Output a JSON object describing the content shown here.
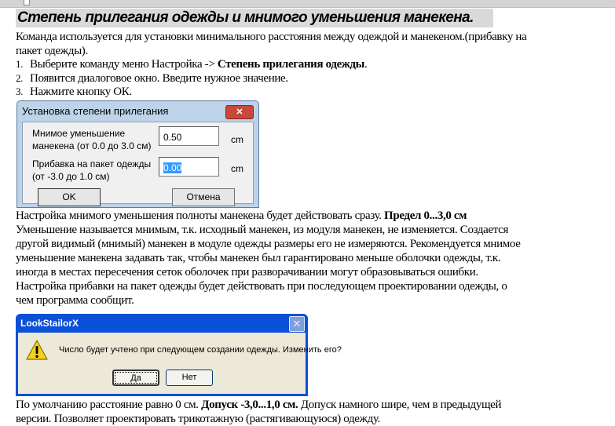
{
  "heading": "Степень прилегания одежды и мнимого уменьшения манекена.",
  "intro": {
    "lines": [
      "Команда используется для установки минимального расстояния между одеждой и манекеном.(прибавку на",
      "пакет одежды)."
    ]
  },
  "steps": [
    {
      "num": "1.",
      "text": "Выберите команду меню Настройка -> ",
      "bold": "Степень прилегания одежды",
      "tail": "."
    },
    {
      "num": "2.",
      "text": "Появится диалоговое окно. Введите нужное значение."
    },
    {
      "num": "3.",
      "text": "Нажмите кнопку ОК."
    }
  ],
  "dialog_fit": {
    "title": "Установка степени прилегания",
    "close_label": "✕",
    "field1": {
      "label_line1": "Мнимое уменьшение",
      "label_line2": "манекена (от 0.0 до 3.0 см)",
      "value": "0.50",
      "unit": "cm"
    },
    "field2": {
      "label_line1": "Прибавка на пакет одежды",
      "label_line2": "(от -3.0 до 1.0 см)",
      "value": "0.00",
      "unit": "cm"
    },
    "ok_label": "OK",
    "cancel_label": "Отмена"
  },
  "body": {
    "line1": {
      "text": "Настройка мнимого уменьшения полноты манекена будет действовать сразу. ",
      "bold": "Предел 0...3,0 см"
    },
    "lines": [
      "Уменьшение называется мнимым, т.к. исходный манекен, из модуля манекен, не изменяется. Создается",
      "другой видимый (мнимый) манекен в модуле одежды размеры его не измеряются. Рекомендуется мнимое",
      "уменьшение манекена задавать так, чтобы манекен был гарантировано меньше оболочки одежды, т.к.",
      "иногда в местах пересечения сеток оболочек при разворачивании могут образовываться ошибки.",
      "Настройка прибавки на пакет одежды будет действовать при последующем проектировании одежды, о",
      "чем программа сообщит."
    ]
  },
  "dialog_confirm": {
    "title": "LookStailorX",
    "close_label": "✕",
    "icon": "warning-icon",
    "message": "Число будет учтено при следующем создании одежды. Изменить его?",
    "yes_label": "Да",
    "no_label": "Нет"
  },
  "footer": {
    "line1": {
      "text": "По умолчанию расстояние равно 0 см. ",
      "bold": "Допуск -3,0...1,0 см.",
      "tail": " Допуск намного шире, чем в предыдущей"
    },
    "line2": "версии. Позволяет проектировать трикотажную (растягивающуюся) одежду."
  }
}
